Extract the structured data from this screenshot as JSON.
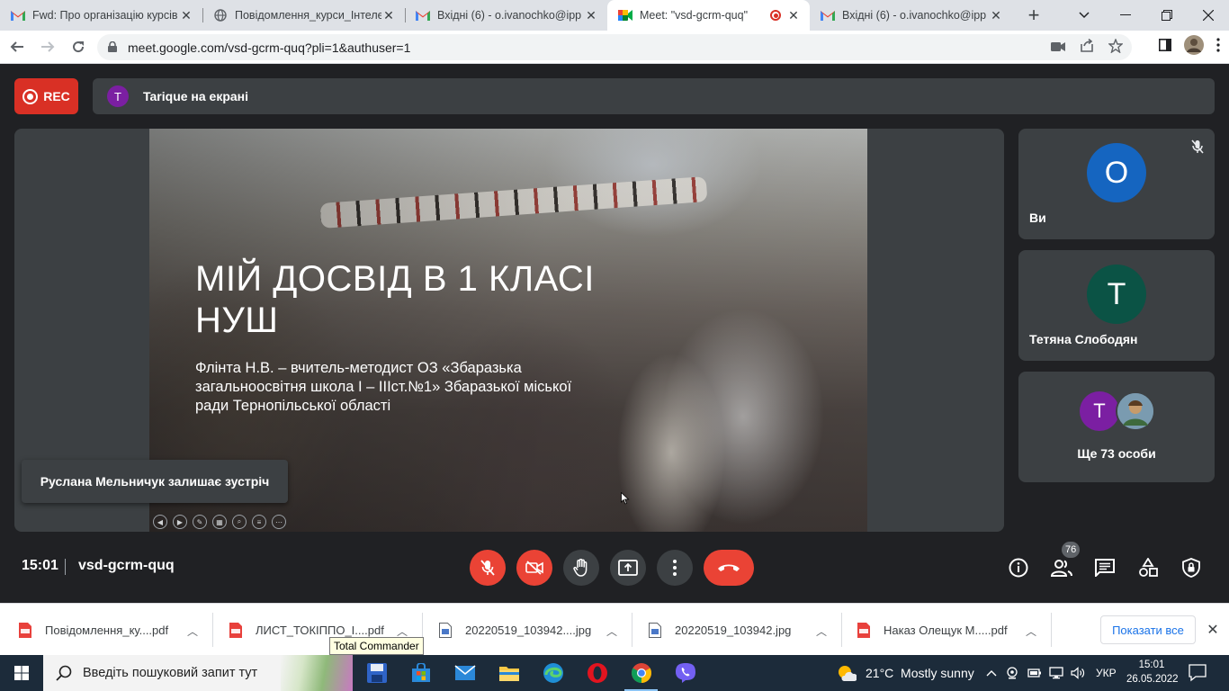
{
  "browser": {
    "tabs": [
      {
        "title": "Fwd: Про організацію курсів",
        "icon": "gmail-icon",
        "active": false
      },
      {
        "title": "Повідомлення_курси_Інтеле",
        "icon": "globe-icon",
        "active": false
      },
      {
        "title": "Вхідні (6) - o.ivanochko@ipp",
        "icon": "gmail-icon",
        "active": false
      },
      {
        "title": "Meet: \"vsd-gcrm-quq\"",
        "icon": "meet-icon",
        "active": true,
        "recording": true
      },
      {
        "title": "Вхідні (6) - o.ivanochko@ipp",
        "icon": "gmail-icon",
        "active": false
      }
    ],
    "new_tab": "+",
    "url": "meet.google.com/vsd-gcrm-quq?pli=1&authuser=1"
  },
  "meet": {
    "rec_label": "REC",
    "presenter_initial": "T",
    "presenter_text": "Tarique на екрані",
    "slide": {
      "title": "МІЙ ДОСВІД В 1 КЛАСІ НУШ",
      "subtitle": "Флінта Н.В. – вчитель-методист ОЗ «Збаразька загальноосвітня школа І – ІІІст.№1» Збаразької міської ради Тернопільської області"
    },
    "toast": "Руслана Мельничук залишає зустріч",
    "participants": [
      {
        "initial": "О",
        "name": "Ви",
        "color": "#1565c0",
        "muted": true
      },
      {
        "initial": "Т",
        "name": "Тетяна Слободян",
        "color": "#0b5345"
      }
    ],
    "more": {
      "initial": "Т",
      "initial_color": "#7b1fa2",
      "label": "Ще 73 особи"
    },
    "time": "15:01",
    "code": "vsd-gcrm-quq",
    "participants_count": "76",
    "colors": {
      "red": "#ea4335",
      "dark": "#202124",
      "tile": "#3c4043"
    }
  },
  "downloads": {
    "items": [
      {
        "name": "Повідомлення_ку....pdf",
        "type": "pdf"
      },
      {
        "name": "ЛИСТ_ТОКІППО_І....pdf",
        "type": "pdf"
      },
      {
        "name": "20220519_103942....jpg",
        "type": "image"
      },
      {
        "name": "20220519_103942.jpg",
        "type": "image"
      },
      {
        "name": "Наказ Олещук М.....pdf",
        "type": "pdf"
      }
    ],
    "show_all": "Показати все",
    "tooltip": "Total Commander"
  },
  "taskbar": {
    "search_placeholder": "Введіть пошуковий запит тут",
    "weather": "21°C  Mostly sunny",
    "lang": "УКР",
    "time": "15:01",
    "date": "26.05.2022"
  }
}
